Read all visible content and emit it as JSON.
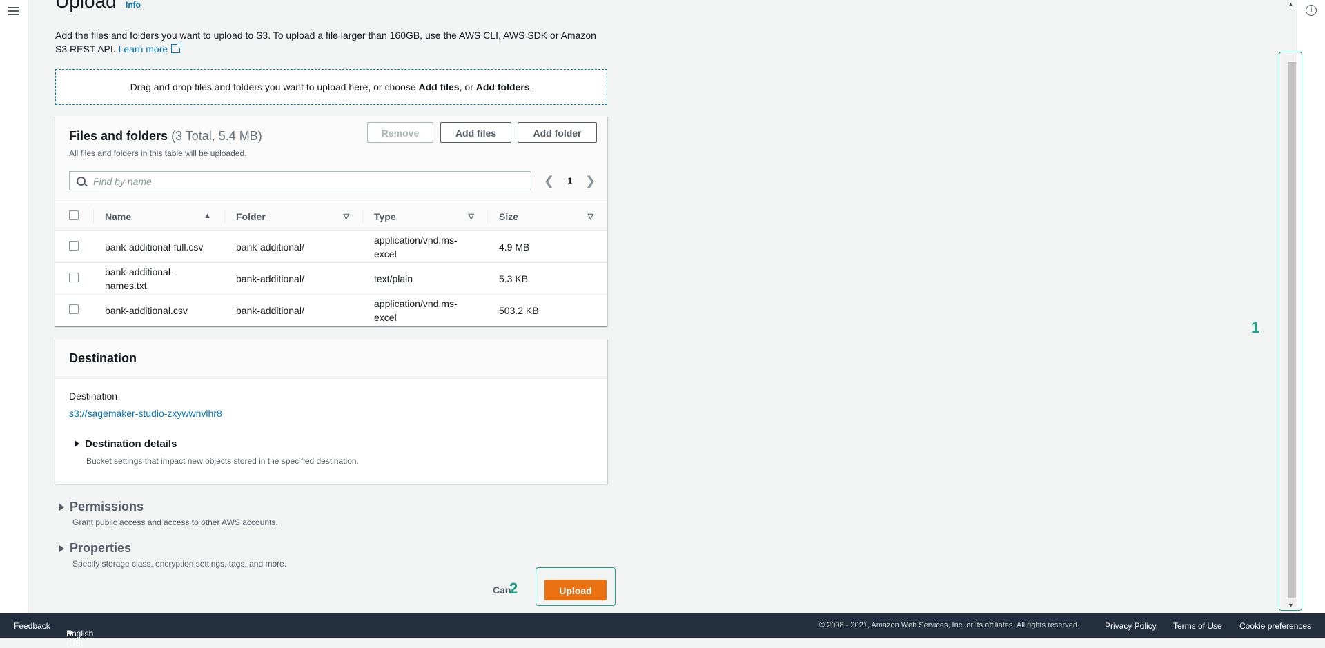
{
  "header": {
    "title": "Upload",
    "info_link": "Info",
    "description": "Add the files and folders you want to upload to S3. To upload a file larger than 160GB, use the AWS CLI, AWS SDK or Amazon S3 REST API.",
    "learn_more": "Learn more"
  },
  "dropzone": {
    "prefix": "Drag and drop files and folders you want to upload here, or choose ",
    "add_files": "Add files",
    "middle": ", or ",
    "add_folders": "Add folders",
    "suffix": "."
  },
  "files_panel": {
    "title": "Files and folders",
    "count": "(3 Total, 5.4 MB)",
    "subtitle": "All files and folders in this table will be uploaded.",
    "remove_label": "Remove",
    "add_files_label": "Add files",
    "add_folder_label": "Add folder",
    "search_placeholder": "Find by name",
    "page": "1",
    "columns": [
      "Name",
      "Folder",
      "Type",
      "Size"
    ],
    "rows": [
      {
        "name": "bank-additional-full.csv",
        "folder": "bank-additional/",
        "type": "application/vnd.ms-excel",
        "size": "4.9 MB"
      },
      {
        "name": "bank-additional-names.txt",
        "folder": "bank-additional/",
        "type": "text/plain",
        "size": "5.3 KB"
      },
      {
        "name": "bank-additional.csv",
        "folder": "bank-additional/",
        "type": "application/vnd.ms-excel",
        "size": "503.2 KB"
      }
    ]
  },
  "destination": {
    "title": "Destination",
    "label": "Destination",
    "uri": "s3://sagemaker-studio-zxywwnvlhr8",
    "details_title": "Destination details",
    "details_sub": "Bucket settings that impact new objects stored in the specified destination."
  },
  "permissions": {
    "title": "Permissions",
    "sub": "Grant public access and access to other AWS accounts."
  },
  "properties": {
    "title": "Properties",
    "sub": "Specify storage class, encryption settings, tags, and more."
  },
  "actions": {
    "cancel_label": "Can",
    "upload_label": "Upload"
  },
  "markers": {
    "scrollbar": "1",
    "upload": "2"
  },
  "footer": {
    "feedback": "Feedback",
    "language": "English (US)",
    "copyright": "© 2008 - 2021, Amazon Web Services, Inc. or its affiliates. All rights reserved.",
    "privacy": "Privacy Policy",
    "terms": "Terms of Use",
    "cookies": "Cookie preferences"
  },
  "colors": {
    "primary_button": "#ec7211",
    "link": "#0073bb",
    "annotation": "#1aa384",
    "footer_bg": "#232f3e"
  }
}
